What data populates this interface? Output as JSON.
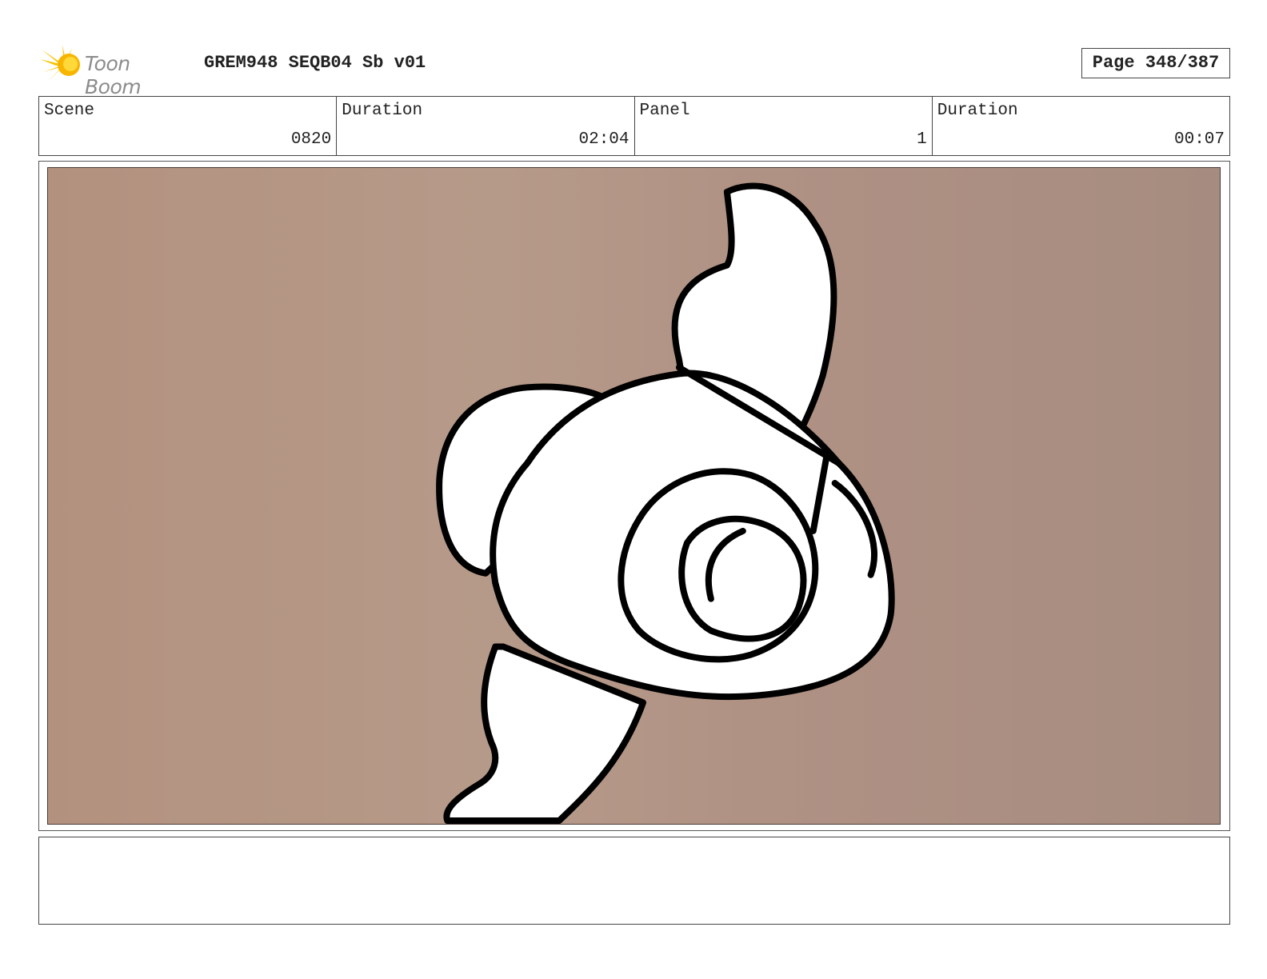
{
  "header": {
    "logo_text": "Toon Boom",
    "title": "GREM948 SEQB04 Sb v01",
    "page": "Page 348/387"
  },
  "info": [
    {
      "label": "Scene",
      "value": "0820"
    },
    {
      "label": "Duration",
      "value": "02:04"
    },
    {
      "label": "Panel",
      "value": "1"
    },
    {
      "label": "Duration",
      "value": "00:07"
    }
  ],
  "notes": "",
  "colors": {
    "panel_background": "#b3917f",
    "logo_yellow": "#f5c400",
    "ink": "#000000"
  }
}
